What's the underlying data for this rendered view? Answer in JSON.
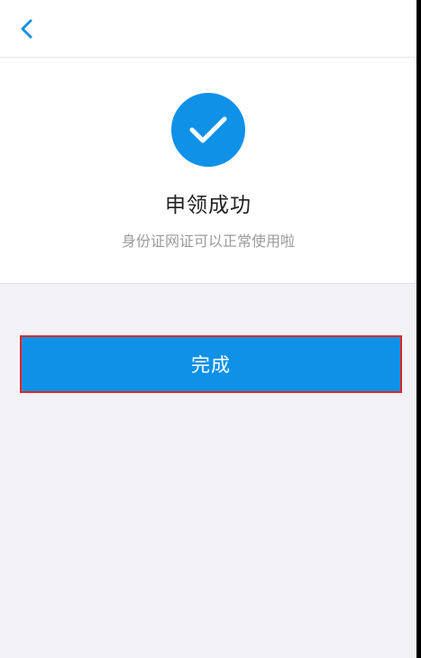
{
  "header": {
    "back_icon": "chevron-left-icon"
  },
  "result": {
    "icon": "check-circle-icon",
    "title": "申领成功",
    "message": "身份证网证可以正常使用啦"
  },
  "actions": {
    "done_label": "完成"
  },
  "colors": {
    "accent": "#0f91e8",
    "background": "#f3f2f7",
    "highlight_border": "#e02626"
  }
}
